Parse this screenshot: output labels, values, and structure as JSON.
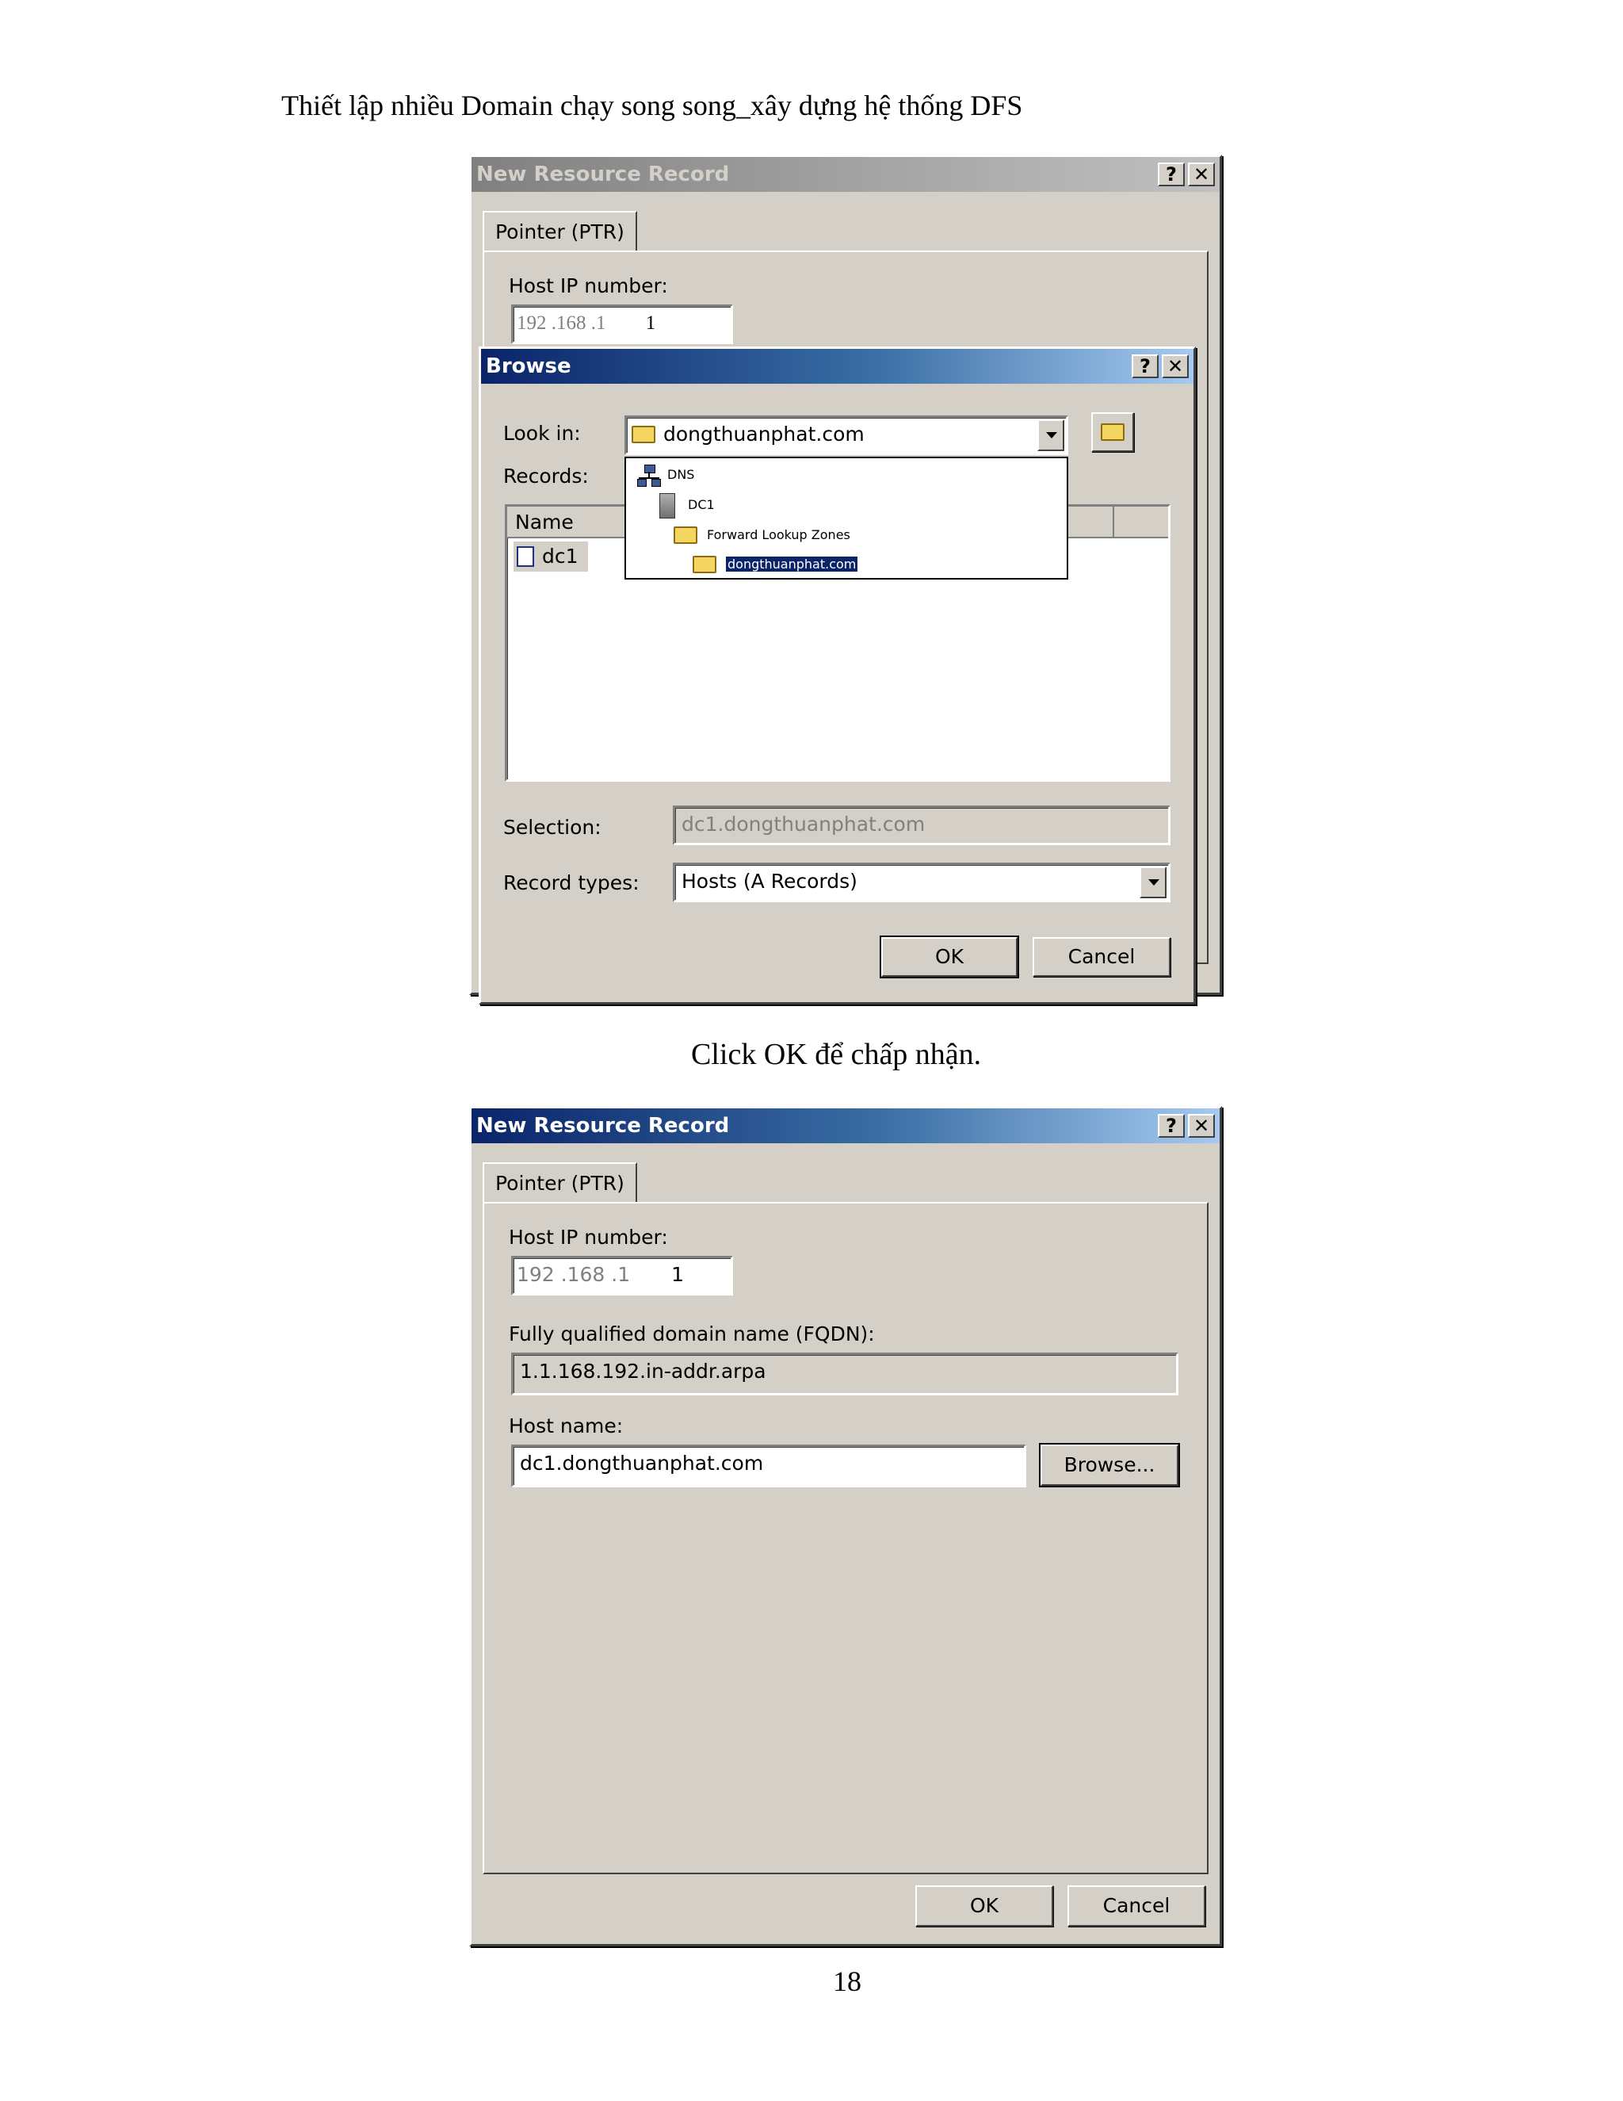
{
  "header": {
    "title": "Thiết lập nhiều Domain chạy song song_xây dựng hệ thống DFS"
  },
  "caption": "Click OK để chấp nhận.",
  "page_number": "18",
  "dialog1": {
    "title": "New Resource Record",
    "help_button": "?",
    "close_button": "✕",
    "tab_label": "Pointer (PTR)",
    "host_ip_label": "Host IP number:",
    "ip_fixed": "192  .168  .1",
    "ip_last": "1"
  },
  "browse": {
    "title": "Browse",
    "help_button": "?",
    "close_button": "✕",
    "look_in_label": "Look in:",
    "look_in_value": "dongthuanphat.com",
    "records_label": "Records:",
    "column_name": "Name",
    "record_item": "dc1",
    "tree": {
      "dns": "DNS",
      "dc1": "DC1",
      "forward": "Forward Lookup Zones",
      "zone": "dongthuanphat.com"
    },
    "selection_label": "Selection:",
    "selection_value": "dc1.dongthuanphat.com",
    "record_types_label": "Record types:",
    "record_types_value": "Hosts (A Records)",
    "ok": "OK",
    "cancel": "Cancel"
  },
  "dialog2": {
    "title": "New Resource Record",
    "help_button": "?",
    "close_button": "✕",
    "tab_label": "Pointer (PTR)",
    "host_ip_label": "Host IP number:",
    "ip_fixed": "192  .168  .1",
    "ip_last": "1",
    "fqdn_label": "Fully qualified domain name (FQDN):",
    "fqdn_value": "1.1.168.192.in-addr.arpa",
    "host_name_label": "Host name:",
    "host_name_value": "dc1.dongthuanphat.com",
    "browse_button": "Browse...",
    "ok": "OK",
    "cancel": "Cancel"
  }
}
